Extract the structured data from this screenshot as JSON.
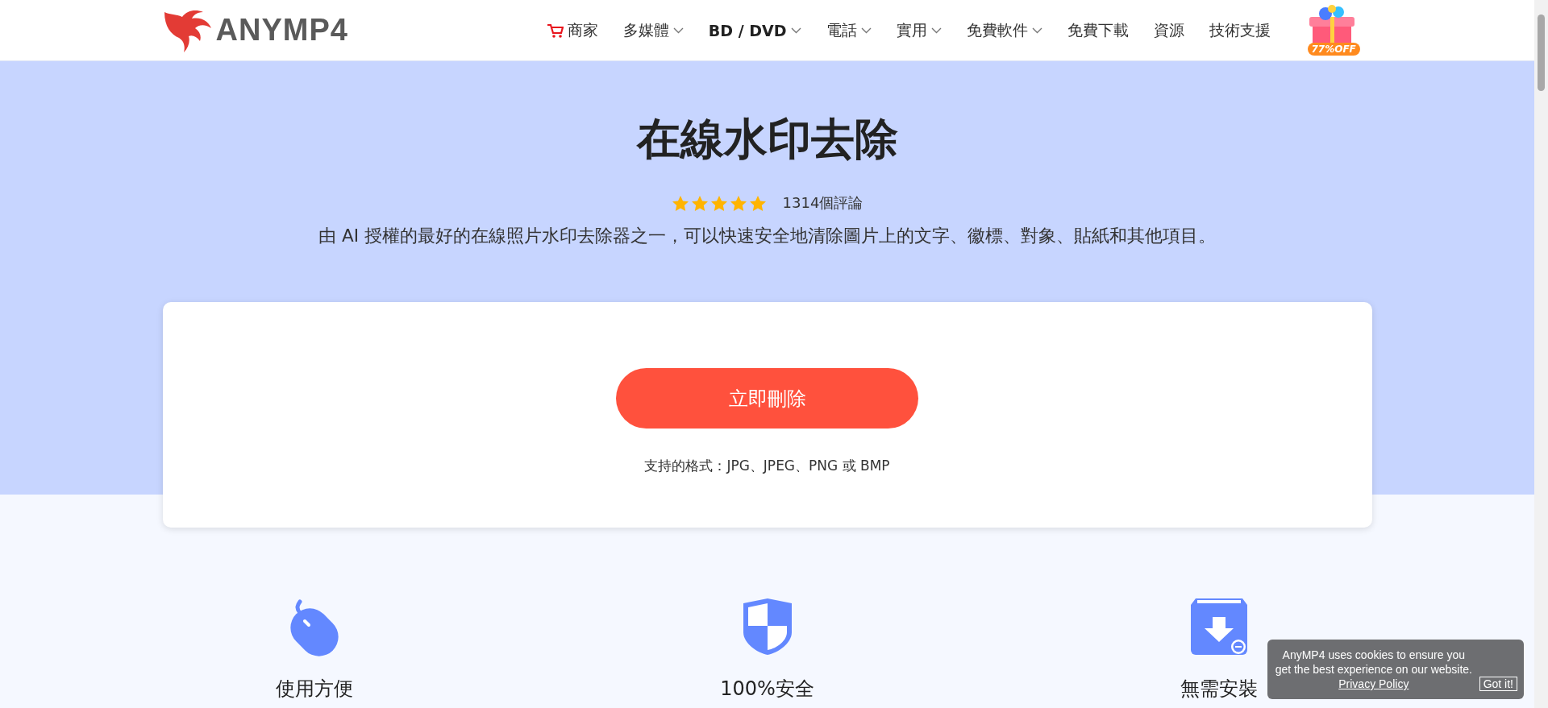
{
  "header": {
    "logo": "ANYMP4",
    "nav": [
      {
        "label": "商家",
        "kind": "cart",
        "has_menu": false,
        "selected": false
      },
      {
        "label": "多媒體",
        "kind": "link",
        "has_menu": true,
        "selected": false
      },
      {
        "label": "BD / DVD",
        "kind": "link",
        "has_menu": true,
        "selected": true
      },
      {
        "label": "電話",
        "kind": "link",
        "has_menu": true,
        "selected": false
      },
      {
        "label": "實用",
        "kind": "link",
        "has_menu": true,
        "selected": false
      },
      {
        "label": "免費軟件",
        "kind": "link",
        "has_menu": true,
        "selected": false
      },
      {
        "label": "免費下載",
        "kind": "link",
        "has_menu": false,
        "selected": false
      },
      {
        "label": "資源",
        "kind": "link",
        "has_menu": false,
        "selected": false
      },
      {
        "label": "技術支援",
        "kind": "link",
        "has_menu": false,
        "selected": false
      }
    ],
    "promo": {
      "label": "77%OFF"
    }
  },
  "hero": {
    "title": "在線水印去除",
    "stars": 5,
    "reviews": "1314個評論",
    "description": "由 AI 授權的最好的在線照片水印去除器之一，可以快速安全地清除圖片上的文字、徽標、對象、貼紙和其他項目。"
  },
  "upload": {
    "button": "立即刪除",
    "formats": "支持的格式：JPG、JPEG、PNG 或 BMP"
  },
  "features": [
    {
      "kind": "mouse",
      "label": "使用方便"
    },
    {
      "kind": "shield",
      "label": "100%安全"
    },
    {
      "kind": "download",
      "label": "無需安裝"
    }
  ],
  "cookie_banner": {
    "text": "AnyMP4 uses cookies to ensure you get the best experience on our website.",
    "link": "Privacy Policy",
    "button": "Got it!"
  }
}
